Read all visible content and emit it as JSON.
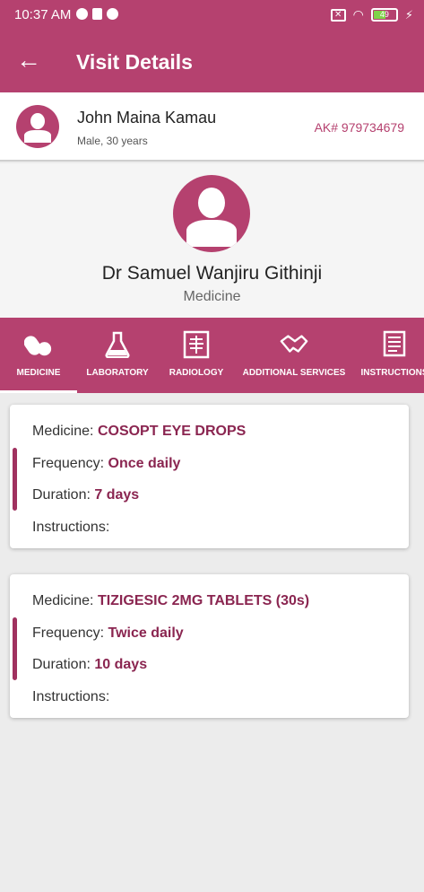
{
  "status_bar": {
    "time": "10:37 AM",
    "battery": "49"
  },
  "header": {
    "title": "Visit Details"
  },
  "patient": {
    "name": "John Maina Kamau",
    "details": "Male, 30 years",
    "account": "AK# 979734679"
  },
  "doctor": {
    "name": "Dr Samuel Wanjiru Githinji",
    "department": "Medicine"
  },
  "tabs": [
    {
      "label": "MEDICINE",
      "icon": "pills-icon"
    },
    {
      "label": "LABORATORY",
      "icon": "flask-icon"
    },
    {
      "label": "RADIOLOGY",
      "icon": "xray-icon"
    },
    {
      "label": "ADDITIONAL SERVICES",
      "icon": "handshake-icon"
    },
    {
      "label": "INSTRUCTIONS",
      "icon": "document-icon"
    }
  ],
  "active_tab": "MEDICINE",
  "labels": {
    "medicine": "Medicine:",
    "frequency": "Frequency:",
    "duration": "Duration:",
    "instructions": "Instructions:"
  },
  "medications": [
    {
      "medicine": "COSOPT EYE DROPS",
      "frequency": "Once daily",
      "duration": "7 days",
      "instructions": ""
    },
    {
      "medicine": "TIZIGESIC 2MG TABLETS (30s)",
      "frequency": "Twice daily",
      "duration": "10 days",
      "instructions": ""
    }
  ],
  "colors": {
    "primary": "#b5416f",
    "accent_text": "#8a2550",
    "background": "#ececec"
  }
}
